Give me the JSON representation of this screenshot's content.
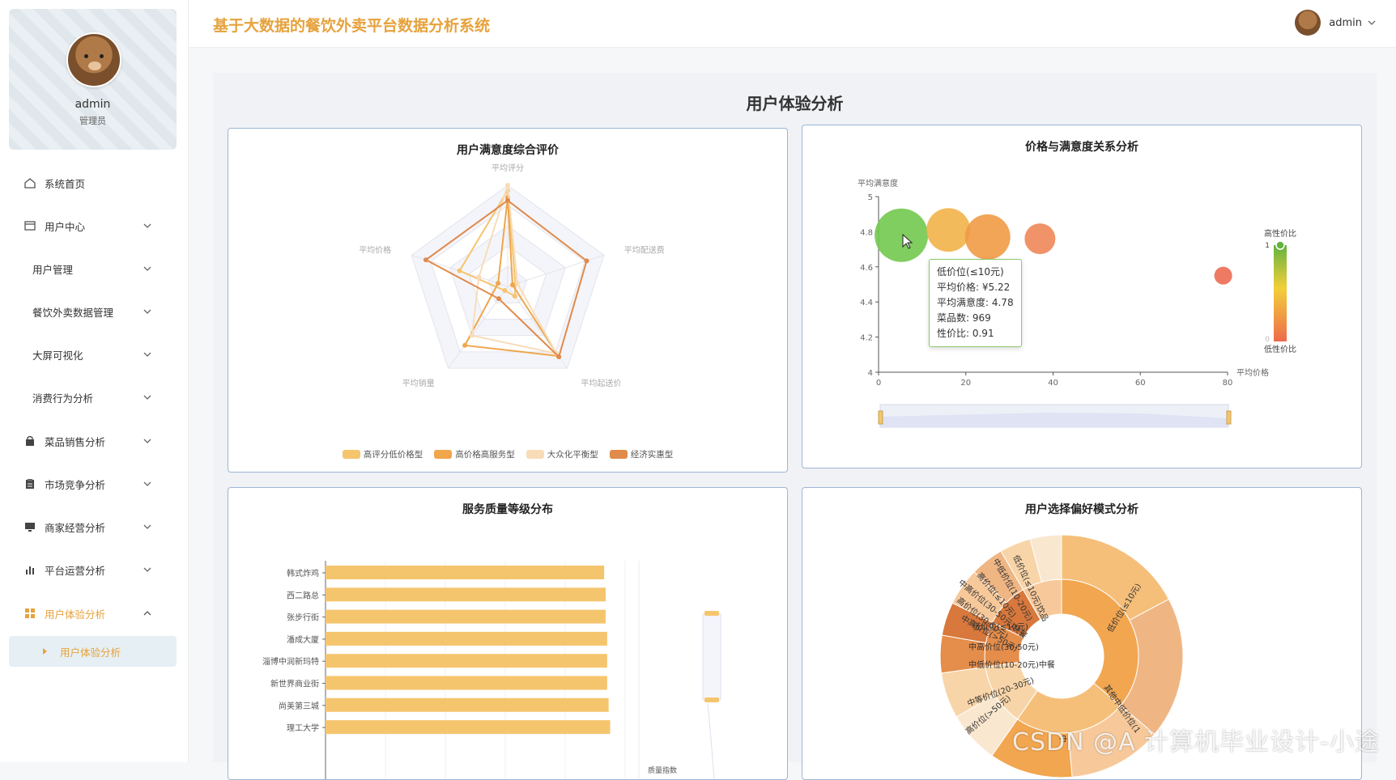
{
  "sidebar": {
    "profile": {
      "name": "admin",
      "role": "管理员"
    },
    "items": [
      {
        "label": "系统首页",
        "icon": "home-icon",
        "has_icon": true
      },
      {
        "label": "用户中心",
        "icon": "user-card-icon",
        "has_icon": true,
        "expandable": true
      },
      {
        "label": "用户管理",
        "has_icon": false,
        "expandable": true
      },
      {
        "label": "餐饮外卖数据管理",
        "has_icon": false,
        "expandable": true
      },
      {
        "label": "大屏可视化",
        "has_icon": false,
        "expandable": true
      },
      {
        "label": "消费行为分析",
        "has_icon": false,
        "expandable": true
      },
      {
        "label": "菜品销售分析",
        "icon": "bag-icon",
        "has_icon": true,
        "expandable": true
      },
      {
        "label": "市场竞争分析",
        "icon": "clipboard-icon",
        "has_icon": true,
        "expandable": true
      },
      {
        "label": "商家经营分析",
        "icon": "monitor-icon",
        "has_icon": true,
        "expandable": true
      },
      {
        "label": "平台运营分析",
        "icon": "bar-chart-icon",
        "has_icon": true,
        "expandable": true
      },
      {
        "label": "用户体验分析",
        "icon": "grid-icon",
        "has_icon": true,
        "expandable": true,
        "active": true
      }
    ],
    "active_sub": "用户体验分析"
  },
  "header": {
    "title": "基于大数据的餐饮外卖平台数据分析系统",
    "user": "admin"
  },
  "page": {
    "title": "用户体验分析"
  },
  "panels": {
    "radar": {
      "title": "用户满意度综合评价"
    },
    "scatter": {
      "title": "价格与满意度关系分析"
    },
    "bars": {
      "title": "服务质量等级分布"
    },
    "sunburst": {
      "title": "用户选择偏好模式分析"
    }
  },
  "tooltip": {
    "lines": [
      "低价位(≤10元)",
      "平均价格: ¥5.22",
      "平均满意度: 4.78",
      "菜品数: 969",
      "性价比: 0.91"
    ]
  },
  "watermark": "CSDN @A 计算机毕业设计-小途",
  "chart_data": [
    {
      "type": "radar",
      "indicators": [
        "平均评分",
        "平均配送费",
        "平均起送价",
        "平均销量",
        "平均价格"
      ],
      "series": [
        {
          "name": "高评分低价格型",
          "color": "#f5c56e",
          "values": [
            0.95,
            0.08,
            0.12,
            0.05,
            0.5
          ]
        },
        {
          "name": "高价格高服务型",
          "color": "#f0a64c",
          "values": [
            0.88,
            0.05,
            0.85,
            0.72,
            0.1
          ]
        },
        {
          "name": "大众化平衡型",
          "color": "#f8dcb8",
          "values": [
            1.0,
            0.1,
            0.82,
            0.6,
            0.3
          ]
        },
        {
          "name": "经济实惠型",
          "color": "#e08a4c",
          "values": [
            0.85,
            0.82,
            0.86,
            0.15,
            0.85
          ]
        }
      ]
    },
    {
      "type": "scatter",
      "xlabel": "平均价格",
      "ylabel": "平均满意度",
      "xlim": [
        0,
        80
      ],
      "ylim": [
        4,
        5
      ],
      "xticks": [
        0,
        20,
        40,
        60,
        80
      ],
      "yticks": [
        4,
        4.2,
        4.4,
        4.6,
        4.8,
        5
      ],
      "visual_map": {
        "high": "高性价比",
        "low": "低性价比",
        "max": 1,
        "min": 0
      },
      "points": [
        {
          "x": 5.22,
          "y": 4.78,
          "r": 33,
          "color": "#72c94e"
        },
        {
          "x": 16,
          "y": 4.81,
          "r": 27,
          "color": "#f2b24a"
        },
        {
          "x": 25,
          "y": 4.77,
          "r": 28,
          "color": "#f19a45"
        },
        {
          "x": 37,
          "y": 4.76,
          "r": 19,
          "color": "#ef8758"
        },
        {
          "x": 79,
          "y": 4.55,
          "r": 11,
          "color": "#ec6c52"
        }
      ]
    },
    {
      "type": "bar",
      "orientation": "horizontal",
      "categories": [
        "韩式炸鸡",
        "西二路总",
        "张步行街",
        "潘成大厦",
        "淄博中润新玛特",
        "新世界商业街",
        "尚美第三城",
        "理工大学"
      ],
      "values": [
        0.93,
        0.935,
        0.935,
        0.94,
        0.94,
        0.94,
        0.945,
        0.95
      ],
      "color": "#f5c56e",
      "side_label": "质量指数"
    },
    {
      "type": "sunburst",
      "labels": [
        "低价位(≤10元)",
        "其他中低价位(1",
        "低价位(≤10元)",
        "中低价位(10-20元)中餐",
        "中等价位(20-30元)",
        "高价位(>50元)",
        "中高价位(30-50元)",
        "中高价位(>50元)",
        "高价位(30-50元)",
        "中高价位(30-50元)快餐",
        "高价位(≤10元)",
        "中低价位(10-20元)",
        "低价位(≤10元)饮品",
        "中"
      ],
      "colors": [
        "#f2a650",
        "#f5bf7a",
        "#f8d5a8",
        "#fae7cf",
        "#e58d4a",
        "#d8783c",
        "#f7c99a",
        "#efb684"
      ]
    }
  ]
}
